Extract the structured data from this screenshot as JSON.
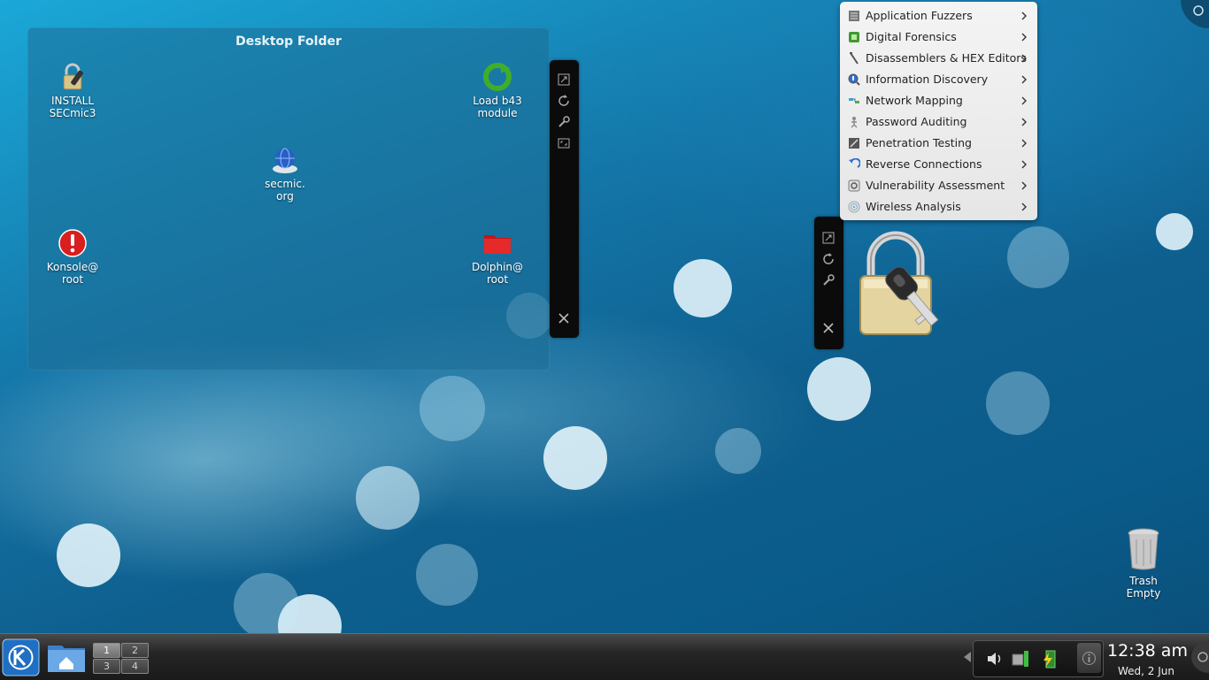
{
  "desktop_folder": {
    "title": "Desktop Folder",
    "icons": [
      {
        "label_line1": "INSTALL",
        "label_line2": "SECmic3",
        "icon": "lock-install-icon"
      },
      {
        "label_line1": "Load b43",
        "label_line2": "module",
        "icon": "reload-green-icon"
      },
      {
        "label_line1": "secmic.",
        "label_line2": "org",
        "icon": "globe-icon"
      },
      {
        "label_line1": "Konsole@",
        "label_line2": "root",
        "icon": "warning-icon"
      },
      {
        "label_line1": "Dolphin@",
        "label_line2": "root",
        "icon": "red-folder-icon"
      }
    ]
  },
  "menu": {
    "items": [
      {
        "label": "Application Fuzzers",
        "icon": "fuzzer-icon"
      },
      {
        "label": "Digital Forensics",
        "icon": "forensics-icon"
      },
      {
        "label": "Disassemblers & HEX Editors",
        "icon": "disassembler-icon"
      },
      {
        "label": "Information Discovery",
        "icon": "info-discovery-icon"
      },
      {
        "label": "Network Mapping",
        "icon": "network-mapping-icon"
      },
      {
        "label": "Password Auditing",
        "icon": "password-icon"
      },
      {
        "label": "Penetration Testing",
        "icon": "pentest-icon"
      },
      {
        "label": "Reverse Connections",
        "icon": "reverse-icon"
      },
      {
        "label": "Vulnerability Assessment",
        "icon": "vuln-icon"
      },
      {
        "label": "Wireless Analysis",
        "icon": "wireless-icon"
      }
    ]
  },
  "trash": {
    "label_line1": "Trash",
    "label_line2": "Empty"
  },
  "panel": {
    "pager": [
      "1",
      "2",
      "3",
      "4"
    ],
    "clock_time": "12:38 am",
    "clock_date": "Wed, 2 Jun"
  },
  "colors": {
    "accent": "#1476a8",
    "panel": "#262626",
    "menu_bg": "#f0f0f0"
  }
}
